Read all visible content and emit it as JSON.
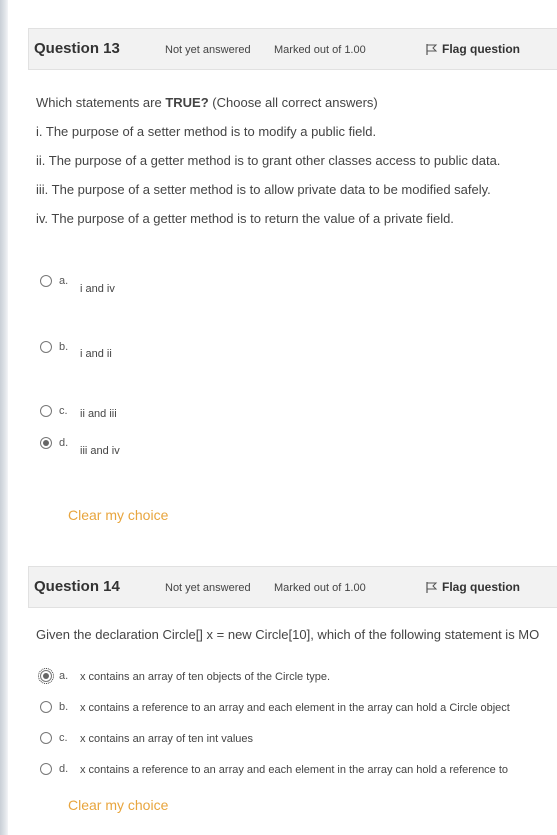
{
  "q13": {
    "header": {
      "number": "Question 13",
      "status": "Not yet answered",
      "marks": "Marked out of 1.00",
      "flag_label": "Flag question",
      "flag_icon": "flag-icon"
    },
    "prompt_prefix": "Which statements are ",
    "prompt_bold": "TRUE?",
    "prompt_suffix": " (Choose all correct answers)",
    "statements": [
      "i.  The purpose of a setter method is to modify a public field.",
      "ii.  The purpose of a getter method is to grant other classes access to public data.",
      "iii. The purpose of a setter method is to allow private data to be modified safely.",
      "iv. The purpose of a getter method is to return the value of a private field."
    ],
    "options": [
      {
        "letter": "a.",
        "text": "i and iv",
        "selected": false
      },
      {
        "letter": "b.",
        "text": "i and ii",
        "selected": false
      },
      {
        "letter": "c.",
        "text": "ii and iii",
        "selected": false
      },
      {
        "letter": "d.",
        "text": "iii and iv",
        "selected": true
      }
    ],
    "clear_label": "Clear my choice"
  },
  "q14": {
    "header": {
      "number": "Question 14",
      "status": "Not yet answered",
      "marks": "Marked out of 1.00",
      "flag_label": "Flag question",
      "flag_icon": "flag-icon"
    },
    "prompt": "Given the declaration Circle[] x = new Circle[10], which of the following statement is MO",
    "options": [
      {
        "letter": "a.",
        "text": "x contains an array of ten objects of the Circle type.",
        "selected": true
      },
      {
        "letter": "b.",
        "text": "x contains a reference to an array and each element in the array can hold a Circle object",
        "selected": false
      },
      {
        "letter": "c.",
        "text": "x contains an array of ten int values",
        "selected": false
      },
      {
        "letter": "d.",
        "text": "x contains a reference to an array and each element in the array can hold a reference to",
        "selected": false
      }
    ],
    "clear_label": "Clear my choice"
  },
  "colors": {
    "accent": "#e8a53d",
    "header_bg": "#f2f2f2"
  }
}
